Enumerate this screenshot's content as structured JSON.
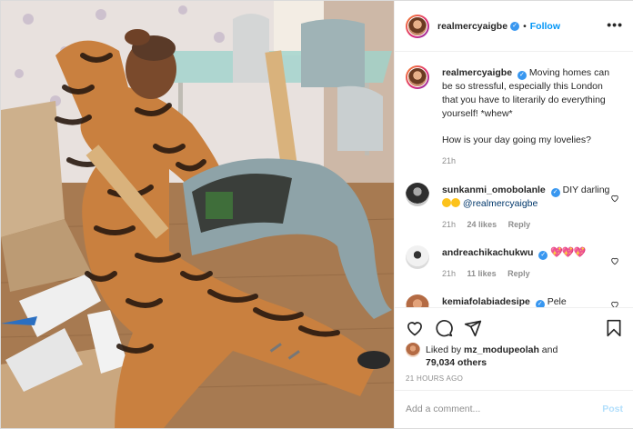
{
  "header": {
    "username": "realmercyaigbe",
    "verified_glyph": "✓",
    "separator": "•",
    "follow_label": "Follow",
    "more_glyph": "•••"
  },
  "caption": {
    "username": "realmercyaigbe",
    "text_1": "Moving homes can be so stressful, especially this London that you have to literarily do everything yourself! *whew*",
    "text_2": "How is your day going my lovelies?",
    "time": "21h"
  },
  "comments": [
    {
      "username": "sunkanmi_omobolanle",
      "text_pre": "DIY darling",
      "mention": "@realmercyaigbe",
      "time": "21h",
      "likes": "24 likes",
      "reply": "Reply"
    },
    {
      "username": "andreachikachukwu",
      "text_emoji": "💖💖💖",
      "time": "21h",
      "likes": "11 likes",
      "reply": "Reply"
    },
    {
      "username": "kemiafolabiadesipe",
      "text": "Pele"
    }
  ],
  "likes": {
    "prefix": "Liked by",
    "liker": "mz_modupeolah",
    "and": "and",
    "count": "79,034 others"
  },
  "timestamp": "21 HOURS AGO",
  "add_comment": {
    "placeholder": "Add a comment...",
    "post_label": "Post"
  },
  "colors": {
    "accent": "#0095f6",
    "verified": "#3897f0",
    "muted": "#8e8e8e",
    "post_disabled": "#b2dffc"
  },
  "icons": [
    "heart-icon",
    "comment-icon",
    "share-icon",
    "bookmark-icon",
    "more-icon",
    "verified-icon"
  ]
}
